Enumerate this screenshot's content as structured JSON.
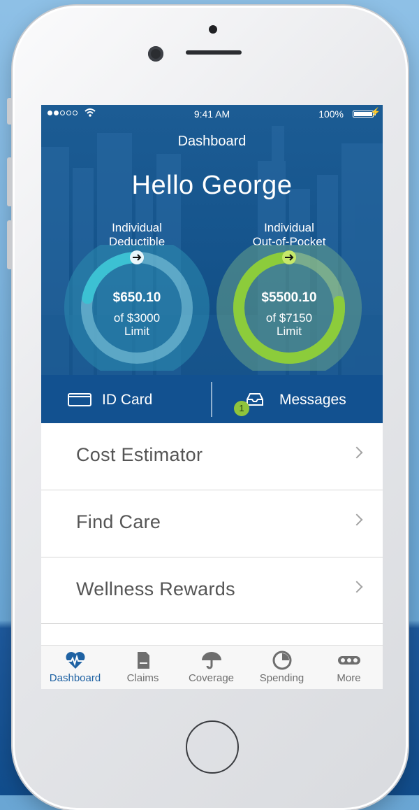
{
  "status_bar": {
    "time": "9:41 AM",
    "battery": "100%"
  },
  "header": {
    "title": "Dashboard",
    "greeting": "Hello George"
  },
  "gauges": [
    {
      "label_line1": "Individual",
      "label_line2": "Deductible",
      "amount": "$650.10",
      "limit_line1": "of $3000",
      "limit_line2": "Limit",
      "progress": 0.22,
      "color": "#3cc1d3"
    },
    {
      "label_line1": "Individual",
      "label_line2": "Out-of-Pocket",
      "amount": "$5500.10",
      "limit_line1": "of $7150",
      "limit_line2": "Limit",
      "progress": 0.77,
      "color": "#8ccc3b"
    }
  ],
  "actions": {
    "id_card": "ID Card",
    "messages": "Messages",
    "messages_badge": "1"
  },
  "menu": [
    {
      "label": "Cost Estimator"
    },
    {
      "label": "Find Care"
    },
    {
      "label": "Wellness Rewards"
    },
    {
      "label": ""
    }
  ],
  "tabs": [
    {
      "label": "Dashboard",
      "icon": "heart-pulse-icon",
      "active": true
    },
    {
      "label": "Claims",
      "icon": "document-icon",
      "active": false
    },
    {
      "label": "Coverage",
      "icon": "umbrella-icon",
      "active": false
    },
    {
      "label": "Spending",
      "icon": "pie-chart-icon",
      "active": false
    },
    {
      "label": "More",
      "icon": "more-icon",
      "active": false
    }
  ],
  "colors": {
    "brand_blue": "#125190",
    "accent_green": "#8fc43c",
    "active_tab": "#1f62a3"
  }
}
